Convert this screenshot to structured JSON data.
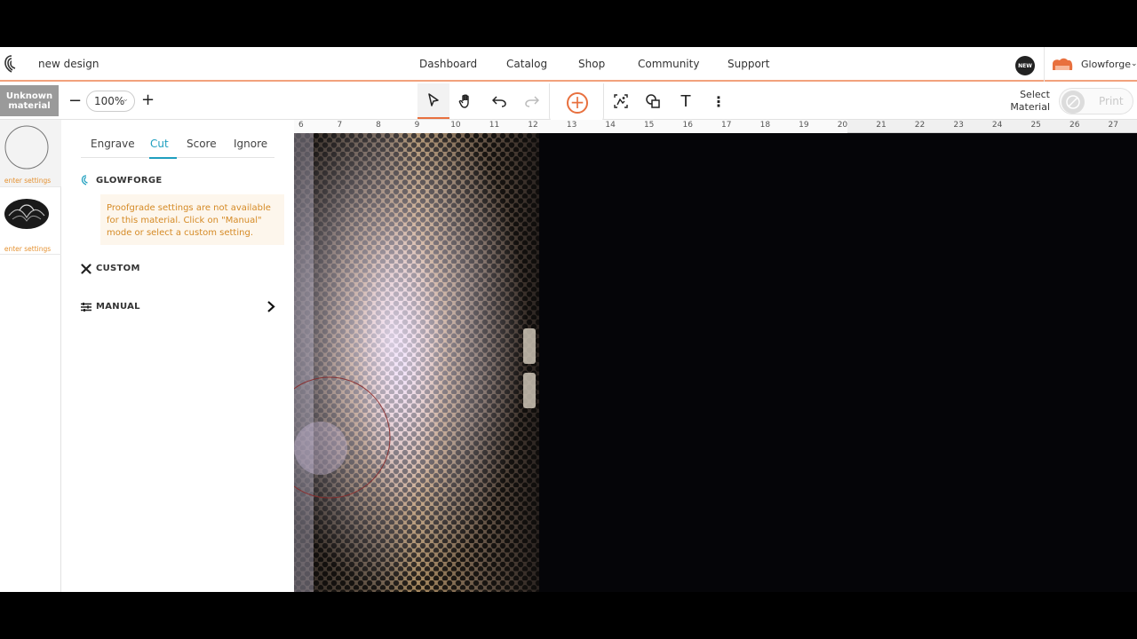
{
  "topnav": {
    "design_title": "new design",
    "links": [
      "Dashboard",
      "Catalog",
      "Shop",
      "Community",
      "Support"
    ],
    "new_badge": "NEW",
    "user_name": "Glowforge",
    "user_chevron": "⌄"
  },
  "toolbar": {
    "material_label": "Unknown material",
    "zoom_minus": "−",
    "zoom_value": "100%",
    "zoom_plus": "+",
    "tools": [
      "select-arrow-icon",
      "hand-pan-icon",
      "undo-icon",
      "redo-icon",
      "add-icon",
      "trace-icon",
      "shapes-icon",
      "text-icon",
      "more-icon"
    ],
    "add_symbol": "+",
    "text_tool": "T",
    "more_symbol": "⋮",
    "select_material": "Select Material",
    "print_label": "Print"
  },
  "thumbs": [
    {
      "label": "enter settings"
    },
    {
      "label": "enter settings"
    }
  ],
  "panel": {
    "tabs": [
      "Engrave",
      "Cut",
      "Score",
      "Ignore"
    ],
    "active_tab": "Cut",
    "glowforge_title": "GLOWFORGE",
    "notice": "Proofgrade settings are not available for this material. Click on \"Manual\" mode or select a custom setting.",
    "custom_title": "CUSTOM",
    "manual_title": "MANUAL",
    "manual_chevron": "›"
  },
  "ruler": {
    "numbers": [
      "6",
      "7",
      "8",
      "9",
      "10",
      "11",
      "12",
      "13",
      "14",
      "15",
      "16",
      "17",
      "18",
      "19",
      "20",
      "21",
      "22",
      "23",
      "24",
      "25",
      "26",
      "27"
    ]
  },
  "colors": {
    "accent_orange": "#e8703e",
    "tab_active": "#1f9fbf",
    "notice_text": "#d58a25",
    "notice_bg": "#fdf6ec",
    "material_btn": "#9a9a9a"
  }
}
